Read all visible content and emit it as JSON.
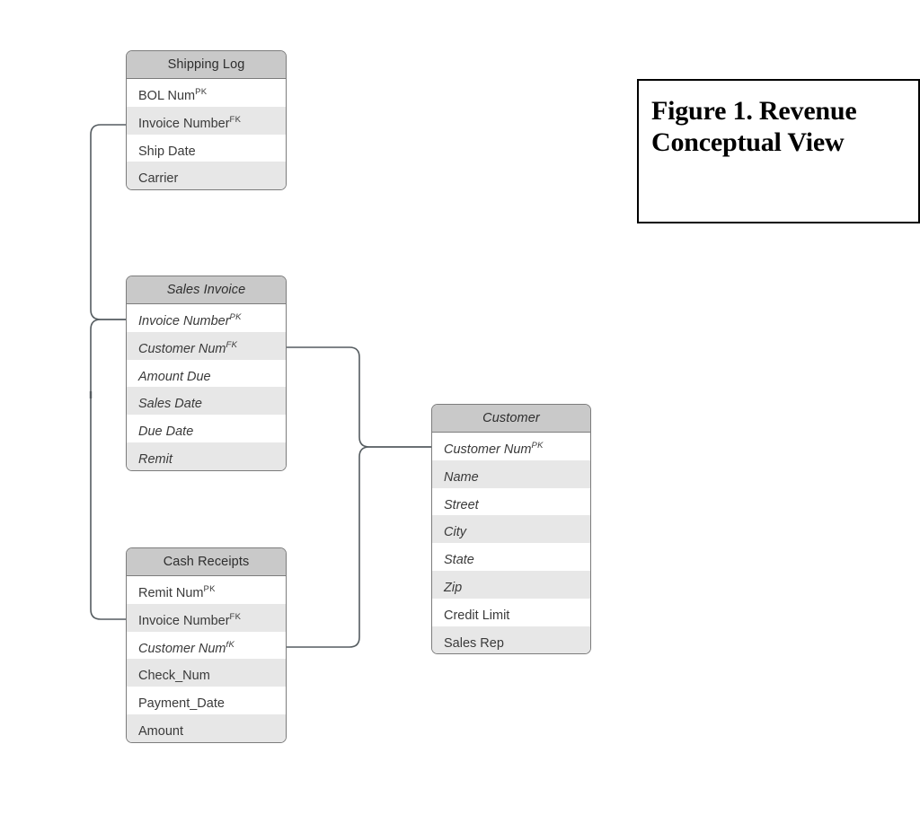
{
  "figure": {
    "caption": "Figure 1. Revenue Conceptual View"
  },
  "colors": {
    "header_fill": "#c9c9c9",
    "row_alt_fill": "#e7e7e7",
    "row_fill": "#ffffff",
    "border": "#7c7c7c",
    "connector": "#555c60",
    "caption_border": "#000000",
    "text": "#3a3a3a"
  },
  "entities": [
    {
      "id": "shipping-log",
      "title": "Shipping Log",
      "title_italic": false,
      "fields": [
        {
          "label": "BOL  Num",
          "key": "PK",
          "italic": false
        },
        {
          "label": "Invoice Number",
          "key": "FK",
          "italic": false
        },
        {
          "label": "Ship Date",
          "key": "",
          "italic": false
        },
        {
          "label": "Carrier",
          "key": "",
          "italic": false
        }
      ]
    },
    {
      "id": "sales-invoice",
      "title": "Sales Invoice",
      "title_italic": true,
      "fields": [
        {
          "label": "Invoice Number",
          "key": "PK",
          "italic": true
        },
        {
          "label": "Customer Num",
          "key": "FK",
          "italic": true
        },
        {
          "label": "Amount Due",
          "key": "",
          "italic": true
        },
        {
          "label": "Sales Date",
          "key": "",
          "italic": true
        },
        {
          "label": "Due Date",
          "key": "",
          "italic": true
        },
        {
          "label": "Remit",
          "key": "",
          "italic": true
        }
      ]
    },
    {
      "id": "cash-receipts",
      "title": "Cash Receipts",
      "title_italic": false,
      "fields": [
        {
          "label": "Remit Num",
          "key": "PK",
          "italic": false
        },
        {
          "label": "Invoice Number",
          "key": "FK",
          "italic": false
        },
        {
          "label": "Customer Num",
          "key": "fK",
          "italic": true
        },
        {
          "label": "Check_Num",
          "key": "",
          "italic": false
        },
        {
          "label": "Payment_Date",
          "key": "",
          "italic": false
        },
        {
          "label": "Amount",
          "key": "",
          "italic": false
        }
      ]
    },
    {
      "id": "customer",
      "title": "Customer",
      "title_italic": true,
      "fields": [
        {
          "label": "Customer Num",
          "key": "PK",
          "italic": true
        },
        {
          "label": "Name",
          "key": "",
          "italic": true
        },
        {
          "label": "Street",
          "key": "",
          "italic": true
        },
        {
          "label": "City",
          "key": "",
          "italic": true
        },
        {
          "label": "State",
          "key": "",
          "italic": true
        },
        {
          "label": "Zip",
          "key": "",
          "italic": true
        },
        {
          "label": "Credit Limit",
          "key": "",
          "italic": false
        },
        {
          "label": "Sales Rep",
          "key": "",
          "italic": false
        }
      ]
    }
  ],
  "relationships": [
    {
      "id": "invoice-to-shipping-log",
      "from": "sales-invoice.Invoice Number",
      "to": "shipping-log.Invoice Number"
    },
    {
      "id": "invoice-to-cash-receipts",
      "from": "sales-invoice.Invoice Number",
      "to": "cash-receipts.Invoice Number"
    },
    {
      "id": "sales-invoice-to-customer",
      "from": "sales-invoice.Customer Num",
      "to": "customer.Customer Num"
    },
    {
      "id": "cash-receipts-to-customer",
      "from": "cash-receipts.Customer Num",
      "to": "customer.Customer Num"
    }
  ]
}
